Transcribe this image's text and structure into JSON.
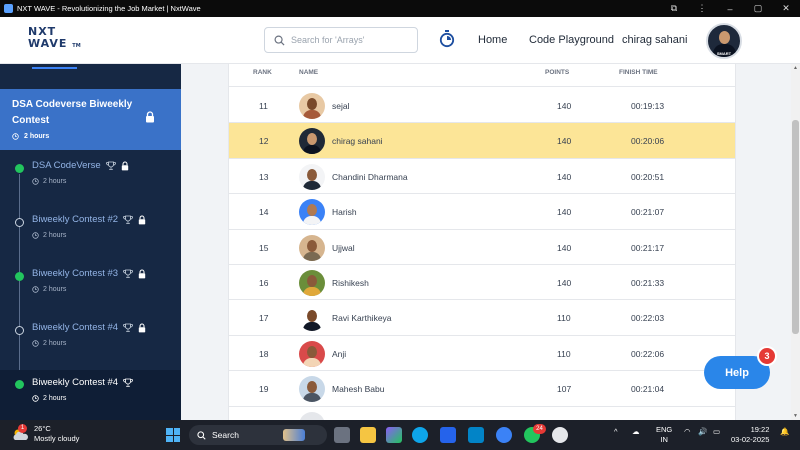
{
  "window": {
    "title": "NXT WAVE - Revolutionizing the Job Market | NxtWave"
  },
  "header": {
    "logo_line1": "NXT",
    "logo_line2": "WAVE",
    "logo_tm": "TM",
    "search_placeholder": "Search for 'Arrays'",
    "nav_home": "Home",
    "nav_playground": "Code Playground",
    "user_name": "chirag sahani",
    "avatar_tag": "SMART"
  },
  "sidebar": {
    "active_contest": {
      "name": "DSA Codeverse Biweekly Contest",
      "duration": "2 hours"
    },
    "stages": [
      {
        "name": "DSA CodeVerse",
        "duration": "2 hours",
        "status": "done",
        "locked": true
      },
      {
        "name": "Biweekly Contest #2",
        "duration": "2 hours",
        "status": "pending",
        "locked": true
      },
      {
        "name": "Biweekly Contest #3",
        "duration": "2 hours",
        "status": "done",
        "locked": true
      },
      {
        "name": "Biweekly Contest #4",
        "duration": "2 hours",
        "status": "pending",
        "locked": true
      },
      {
        "name": "Biweekly Contest #4",
        "duration": "2 hours",
        "status": "done",
        "locked": false
      }
    ]
  },
  "leaderboard": {
    "columns": {
      "rank": "RANK",
      "name": "NAME",
      "points": "POINTS",
      "finish_time": "FINISH TIME"
    },
    "rows": [
      {
        "rank": "11",
        "name": "sejal",
        "points": "140",
        "time": "00:19:13",
        "highlight": false
      },
      {
        "rank": "12",
        "name": "chirag sahani",
        "points": "140",
        "time": "00:20:06",
        "highlight": true
      },
      {
        "rank": "13",
        "name": "Chandini Dharmana",
        "points": "140",
        "time": "00:20:51",
        "highlight": false
      },
      {
        "rank": "14",
        "name": "Harish",
        "points": "140",
        "time": "00:21:07",
        "highlight": false
      },
      {
        "rank": "15",
        "name": "Ujjwal",
        "points": "140",
        "time": "00:21:17",
        "highlight": false
      },
      {
        "rank": "16",
        "name": "Rishikesh",
        "points": "140",
        "time": "00:21:33",
        "highlight": false
      },
      {
        "rank": "17",
        "name": "Ravi Karthikeya",
        "points": "110",
        "time": "00:22:03",
        "highlight": false
      },
      {
        "rank": "18",
        "name": "Anji",
        "points": "110",
        "time": "00:22:06",
        "highlight": false
      },
      {
        "rank": "19",
        "name": "Mahesh Babu",
        "points": "107",
        "time": "00:21:04",
        "highlight": false
      }
    ]
  },
  "help": {
    "label": "Help",
    "badge": "3"
  },
  "taskbar": {
    "weather_temp": "26°C",
    "weather_desc": "Mostly cloudy",
    "weather_badge": "1",
    "search_label": "Search",
    "whatsapp_badge": "24",
    "lang_line1": "ENG",
    "lang_line2": "IN",
    "time": "19:22",
    "date": "03-02-2025"
  },
  "colors": {
    "sidebar_bg": "#162844",
    "active_contest_bg": "#3a72c8",
    "highlight_row": "#fce597",
    "help_button": "#2a86e9",
    "badge_red": "#e53935",
    "done_green": "#22c55e"
  }
}
